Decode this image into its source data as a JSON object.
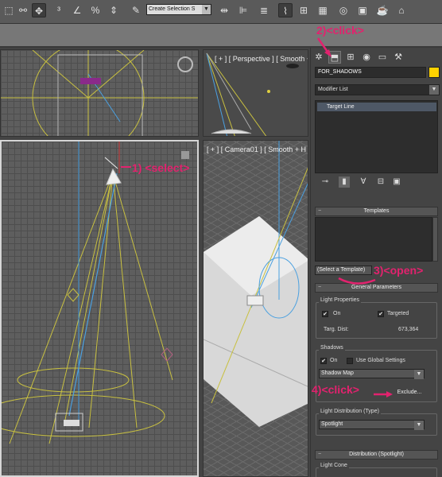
{
  "toolbar": {
    "icons": [
      "select-region-icon",
      "link-icon",
      "move-icon",
      "snap-3d-icon",
      "angle-snap-icon",
      "percent-snap-icon",
      "spinner-snap-icon",
      "edit-named-sets-icon",
      "mirror-icon",
      "align-icon",
      "layer-manager-icon",
      "curve-editor-icon",
      "schematic-view-icon",
      "material-editor-icon",
      "render-setup-icon",
      "rendered-frame-icon",
      "render-icon"
    ],
    "named_selection": "Create Selection S"
  },
  "viewports": {
    "top_right_label": "[ + ] [ Perspective ] [ Smooth + H",
    "bottom_right_label": "[ + ] [ Camera01 ] [ Smooth + H"
  },
  "panel": {
    "tabs": [
      "create-tab",
      "modify-tab",
      "hierarchy-tab",
      "motion-tab",
      "display-tab",
      "utilities-tab"
    ],
    "object_name": "FOR_SHADOWS",
    "object_color": "#ffd200",
    "modifier_list": "Modifier List",
    "stack_item": "Target Line",
    "templates": {
      "title": "Templates",
      "select_label": "(Select a Template)"
    },
    "general": {
      "title": "General Parameters",
      "light_properties": "Light Properties",
      "on_label": "On",
      "targeted_label": "Targeted",
      "targ_dist_label": "Targ. Dist:",
      "targ_dist_value": "673,364",
      "shadows_title": "Shadows",
      "shadows_on_label": "On",
      "use_global_label": "Use Global Settings",
      "shadow_type": "Shadow Map",
      "exclude_label": "Exclude..."
    },
    "light_distribution": {
      "title": "Light Distribution (Type)",
      "value": "Spotlight"
    },
    "distribution_spot": {
      "title": "Distribution (Spotlight)",
      "light_cone": "Light Cone"
    }
  },
  "annotations": {
    "step1": "1) <select>",
    "step2": "2)<click>",
    "step3": "3)<open>",
    "step4": "4)<click>"
  },
  "colors": {
    "annotation": "#e2226e",
    "light_cone": "#c8c040",
    "target_line": "#4aa0e0"
  }
}
